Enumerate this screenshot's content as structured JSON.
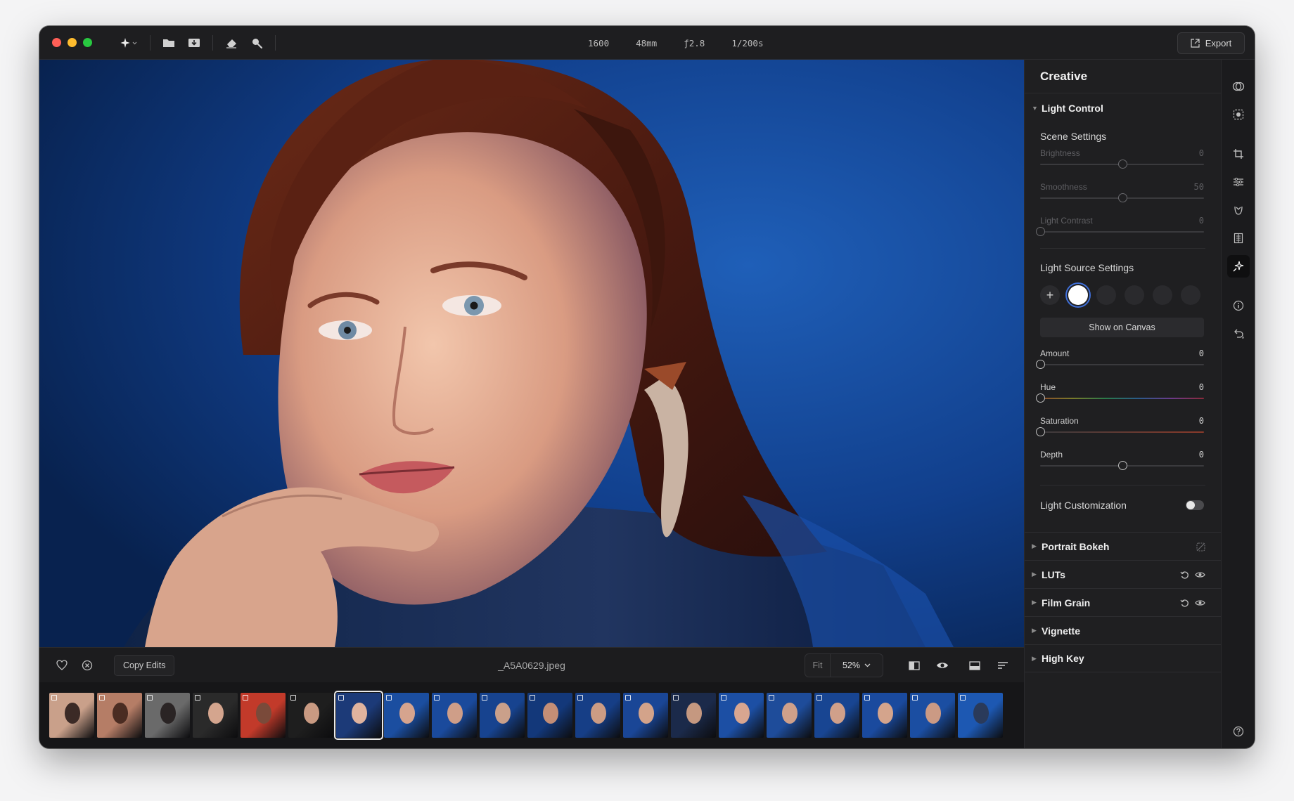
{
  "titlebar": {
    "traffic_lights": [
      "#ff5f57",
      "#febc2e",
      "#28c840"
    ],
    "tools": [
      "magic-wand-icon",
      "folder-icon",
      "import-icon",
      "eraser-icon",
      "search-icon"
    ],
    "exif": {
      "iso": "1600",
      "focal": "48mm",
      "aperture": "ƒ2.8",
      "shutter": "1/200s"
    },
    "export_label": "Export"
  },
  "bottombar": {
    "copy_edits_label": "Copy Edits",
    "filename": "_A5A0629.jpeg",
    "fit_label": "Fit",
    "zoom_value": "52%"
  },
  "filmstrip": {
    "thumbnail_count": 20,
    "selected_index": 6
  },
  "panel": {
    "title": "Creative",
    "light_control": {
      "title": "Light Control",
      "scene_settings": {
        "title": "Scene Settings",
        "sliders": [
          {
            "label": "Brightness",
            "value": "0",
            "position": 0.5
          },
          {
            "label": "Smoothness",
            "value": "50",
            "position": 0.5
          },
          {
            "label": "Light Contrast",
            "value": "0",
            "position": 0.0
          }
        ]
      },
      "light_source": {
        "title": "Light Source Settings",
        "show_on_canvas_label": "Show on Canvas",
        "sliders": [
          {
            "label": "Amount",
            "value": "0",
            "position": 0.0
          },
          {
            "label": "Hue",
            "value": "0",
            "position": 0.0
          },
          {
            "label": "Saturation",
            "value": "0",
            "position": 0.0
          },
          {
            "label": "Depth",
            "value": "0",
            "position": 0.5
          }
        ]
      },
      "light_customization_label": "Light Customization",
      "light_customization_on": false
    },
    "sections": [
      "Portrait Bokeh",
      "LUTs",
      "Film Grain",
      "Vignette",
      "High Key"
    ]
  },
  "accent_color": "#3f6fd8"
}
